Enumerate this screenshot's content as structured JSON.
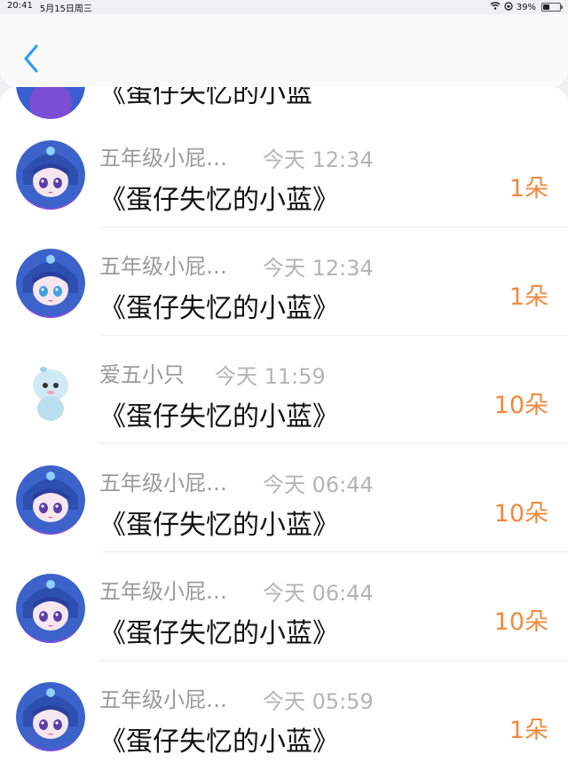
{
  "status_bar": {
    "time": "20:41",
    "date": "5月15日周三",
    "battery": "39%"
  },
  "nav": {
    "back_icon": "chevron-left-icon"
  },
  "partial_message": "《蛋仔失忆的小蓝",
  "rows": [
    {
      "name": "五年级小屁…",
      "time": "今天 12:34",
      "message": "《蛋仔失忆的小蓝》",
      "amount": "1朵",
      "avatar": "blue-hood-avatar"
    },
    {
      "name": "五年级小屁…",
      "time": "今天 12:34",
      "message": "《蛋仔失忆的小蓝》",
      "amount": "1朵",
      "avatar": "blue-hood-avatar"
    },
    {
      "name": "爱五小只",
      "time": "今天 11:59",
      "message": "《蛋仔失忆的小蓝》",
      "amount": "10朵",
      "avatar": "white-mascot-avatar"
    },
    {
      "name": "五年级小屁…",
      "time": "今天 06:44",
      "message": "《蛋仔失忆的小蓝》",
      "amount": "10朵",
      "avatar": "blue-hood-avatar"
    },
    {
      "name": "五年级小屁…",
      "time": "今天 06:44",
      "message": "《蛋仔失忆的小蓝》",
      "amount": "10朵",
      "avatar": "blue-hood-avatar"
    },
    {
      "name": "五年级小屁…",
      "time": "今天 05:59",
      "message": "《蛋仔失忆的小蓝》",
      "amount": "1朵",
      "avatar": "blue-hood-avatar"
    }
  ],
  "colors": {
    "accent_blue": "#2f9cf4",
    "amount_orange": "#f08a3c"
  }
}
